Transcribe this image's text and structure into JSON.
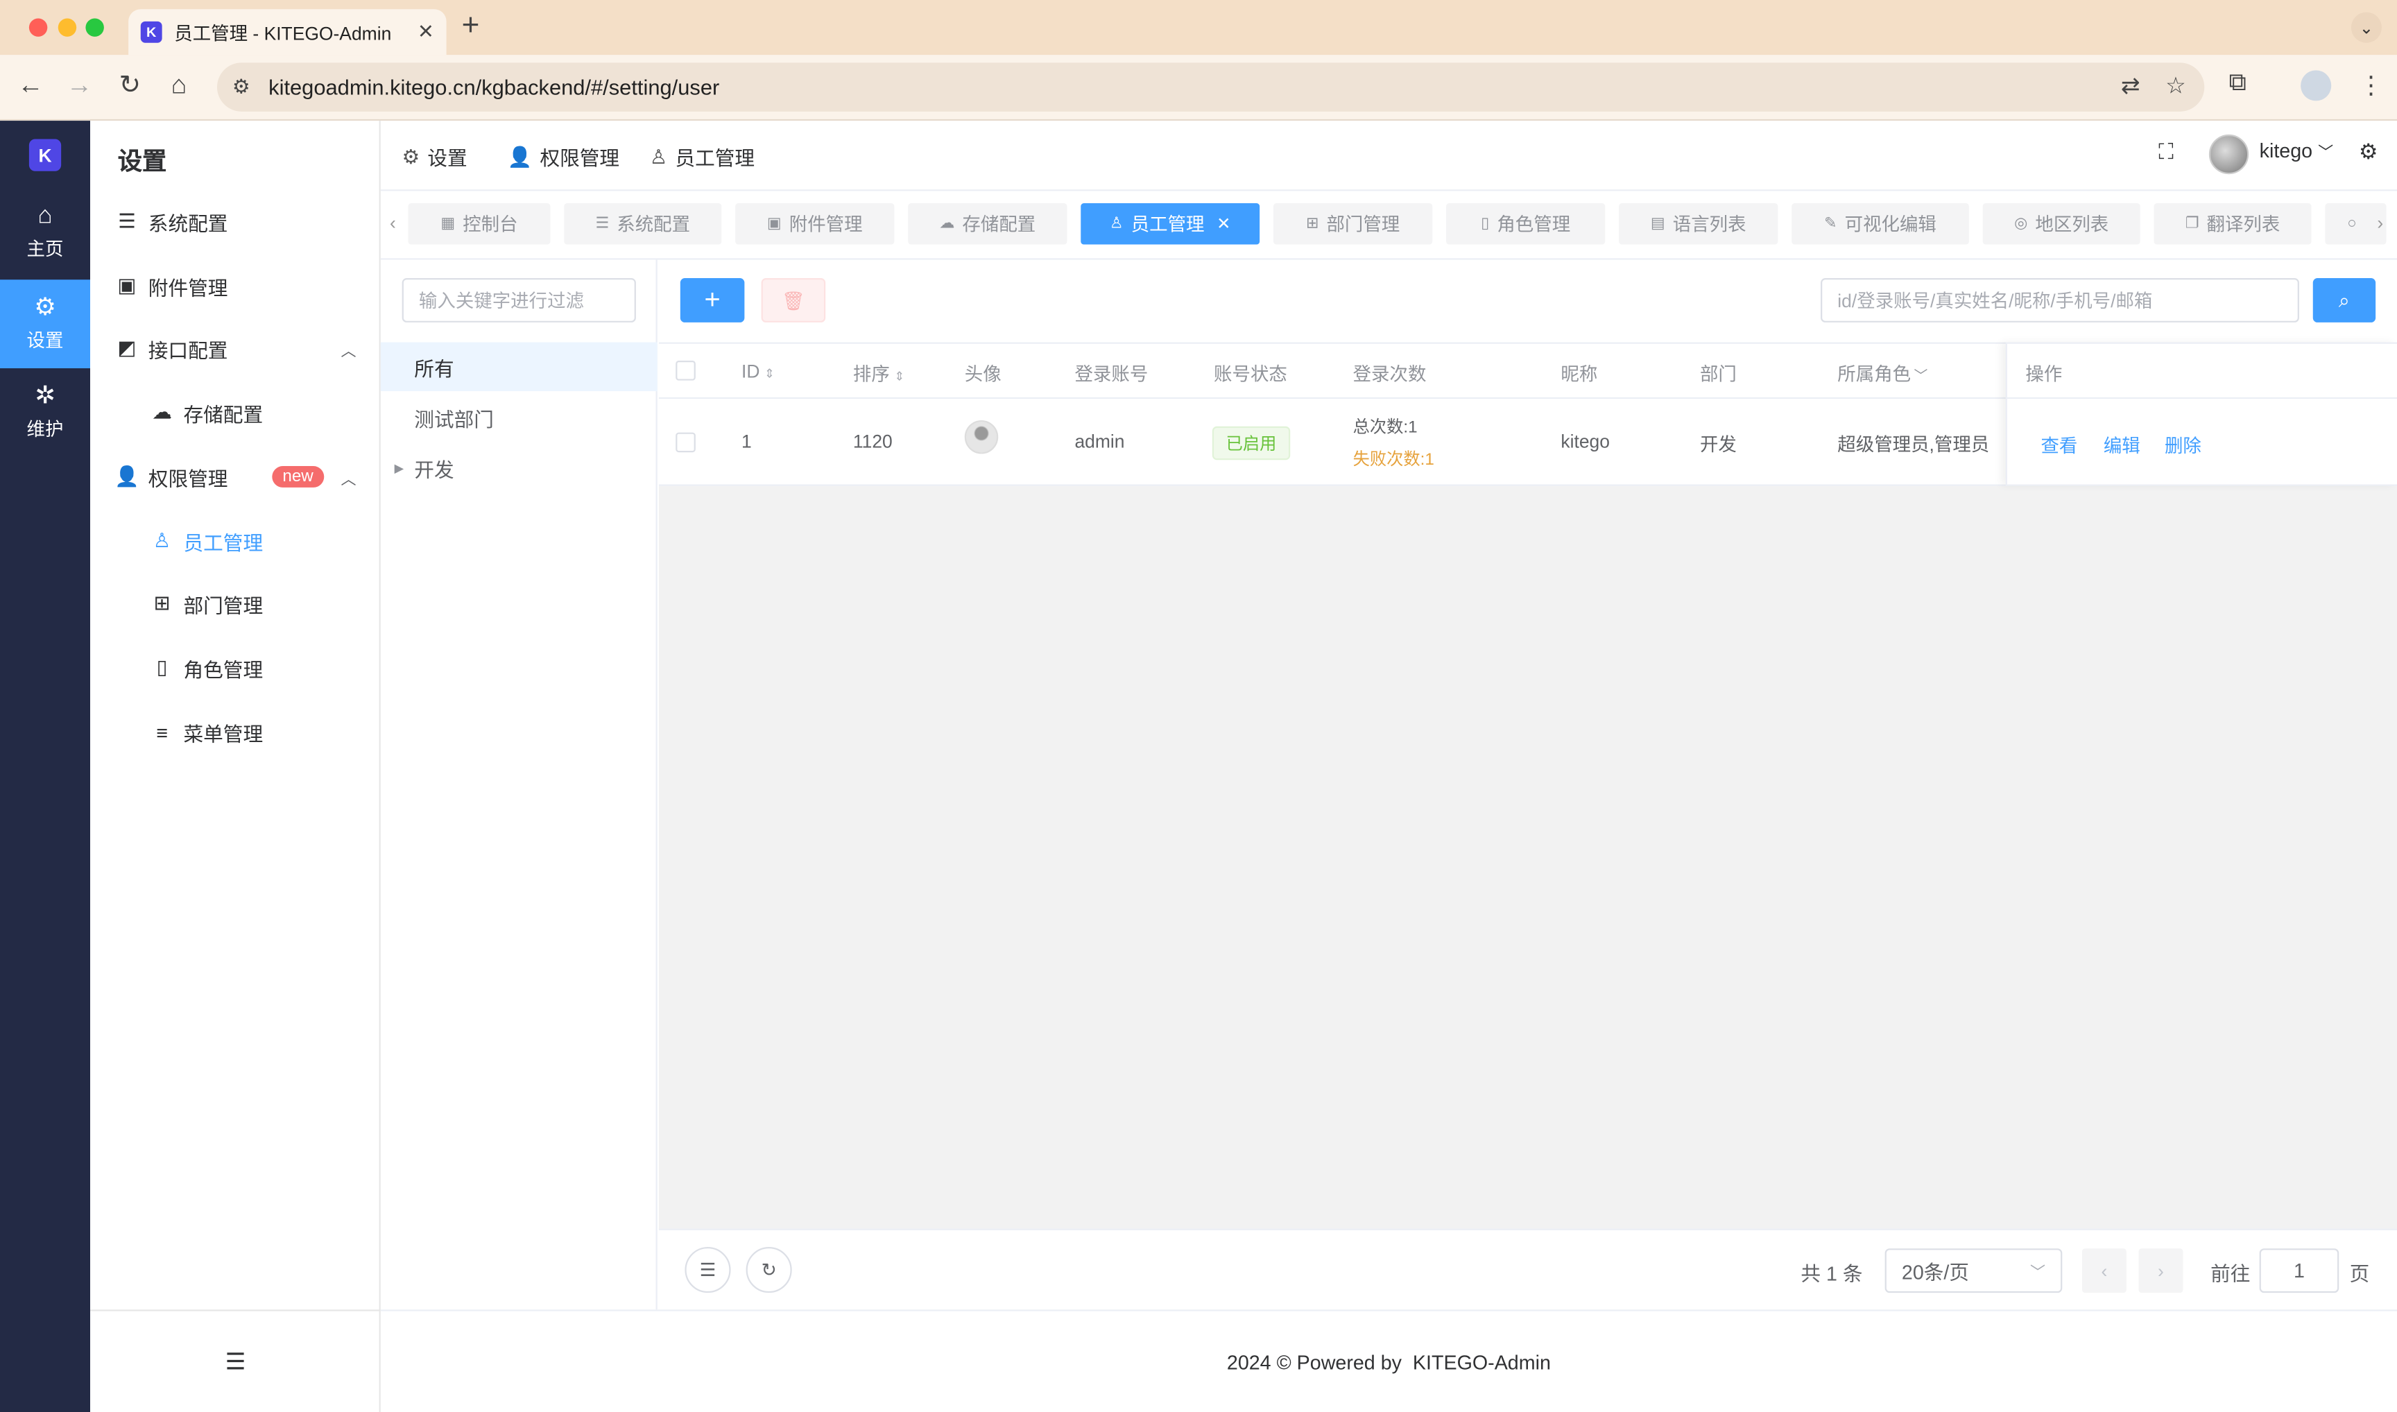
{
  "browser": {
    "tab_title": "员工管理 - KITEGO-Admin",
    "favicon_text": "K",
    "url": "kitegoadmin.kitego.cn/kgbackend/#/setting/user",
    "traffic_colors": [
      "#ff5f57",
      "#febc2e",
      "#28c840"
    ]
  },
  "rail": {
    "logo_text": "K",
    "items": [
      {
        "label": "主页",
        "icon": "home-icon"
      },
      {
        "label": "设置",
        "icon": "gear-icon"
      },
      {
        "label": "维护",
        "icon": "bug-icon"
      }
    ]
  },
  "menu": {
    "title": "设置",
    "items": [
      {
        "label": "系统配置",
        "icon": "sliders-icon"
      },
      {
        "label": "附件管理",
        "icon": "image-icon"
      },
      {
        "label": "接口配置",
        "icon": "chart-icon"
      },
      {
        "label": "存储配置",
        "icon": "cloud-icon"
      },
      {
        "label": "权限管理",
        "icon": "user-icon",
        "badge": "new"
      },
      {
        "label": "员工管理",
        "icon": "user-outline-icon"
      },
      {
        "label": "部门管理",
        "icon": "org-icon"
      },
      {
        "label": "角色管理",
        "icon": "book-icon"
      },
      {
        "label": "菜单管理",
        "icon": "menu-icon"
      }
    ]
  },
  "header": {
    "breadcrumb": [
      {
        "label": "设置",
        "icon": "gear-icon"
      },
      {
        "label": "权限管理",
        "icon": "user-icon"
      },
      {
        "label": "员工管理",
        "icon": "user-outline-icon"
      }
    ],
    "username": "kitego"
  },
  "tags": [
    {
      "label": "控制台",
      "active": false
    },
    {
      "label": "系统配置",
      "active": false
    },
    {
      "label": "附件管理",
      "active": false
    },
    {
      "label": "存储配置",
      "active": false
    },
    {
      "label": "员工管理",
      "active": true
    },
    {
      "label": "部门管理",
      "active": false
    },
    {
      "label": "角色管理",
      "active": false
    },
    {
      "label": "语言列表",
      "active": false
    },
    {
      "label": "可视化编辑",
      "active": false
    },
    {
      "label": "地区列表",
      "active": false
    },
    {
      "label": "翻译列表",
      "active": false
    }
  ],
  "dept": {
    "filter_placeholder": "输入关键字进行过滤",
    "nodes": [
      "所有",
      "测试部门",
      "开发"
    ]
  },
  "toolbar": {
    "add_label": "+",
    "search_placeholder": "id/登录账号/真实姓名/昵称/手机号/邮箱"
  },
  "table": {
    "columns": [
      "ID",
      "排序",
      "头像",
      "登录账号",
      "账号状态",
      "登录次数",
      "昵称",
      "部门",
      "所属角色",
      "操作"
    ],
    "rows": [
      {
        "id": "1",
        "sort": "1120",
        "account": "admin",
        "status": "已启用",
        "total_logins": "总次数:1",
        "failed_logins": "失败次数:1",
        "nickname": "kitego",
        "department": "开发",
        "roles": "超级管理员,管理员",
        "actions": [
          "查看",
          "编辑",
          "删除"
        ]
      }
    ]
  },
  "pagination": {
    "total": "共 1 条",
    "page_size": "20条/页",
    "goto_label": "前往",
    "goto_value": "1",
    "page_suffix": "页"
  },
  "footer": {
    "text": "2024 © Powered by  KITEGO-Admin"
  }
}
